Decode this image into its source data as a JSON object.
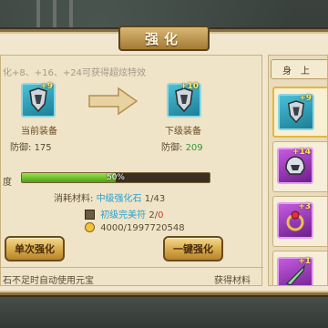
{
  "title": "强化",
  "info_line": "化+8、+16、+24可获得超炫特效",
  "current_equip": {
    "label": "当前装备",
    "defense_label": "防御:",
    "defense_value": "175",
    "bonus": "+9"
  },
  "next_equip": {
    "label": "下级装备",
    "defense_label": "防御:",
    "defense_value": "209",
    "bonus": "+10"
  },
  "progress": {
    "label": "度",
    "percent_text": "50%",
    "value": 0.5
  },
  "materials": {
    "consume_label": "消耗材料:",
    "stone_name": "中级强化石",
    "stone_count": "1/43",
    "charm_name": "初级完美符",
    "charm_have": "2/",
    "charm_need": "0",
    "gold": "4000/1997720548"
  },
  "buttons": {
    "single": "单次强化",
    "one_click": "一键强化"
  },
  "footer": {
    "auto_yuanbao": "石不足时自动使用元宝",
    "obtain": "获得材料"
  },
  "side": {
    "tab_label": "身上",
    "items": [
      {
        "bonus": "+9",
        "quality": "teal",
        "icon": "shield-icon"
      },
      {
        "bonus": "+14",
        "quality": "purple",
        "icon": "helmet-icon"
      },
      {
        "bonus": "+3",
        "quality": "purple",
        "icon": "ring-icon"
      },
      {
        "bonus": "+1",
        "quality": "purple",
        "icon": "blade-icon"
      }
    ]
  },
  "colors": {
    "accent_gold": "#d6a94a",
    "progress_green": "#6fc12c",
    "value_up_green": "#2f9a3a",
    "material_blue": "#2a9fd0",
    "warning_red": "#d63a2a"
  }
}
